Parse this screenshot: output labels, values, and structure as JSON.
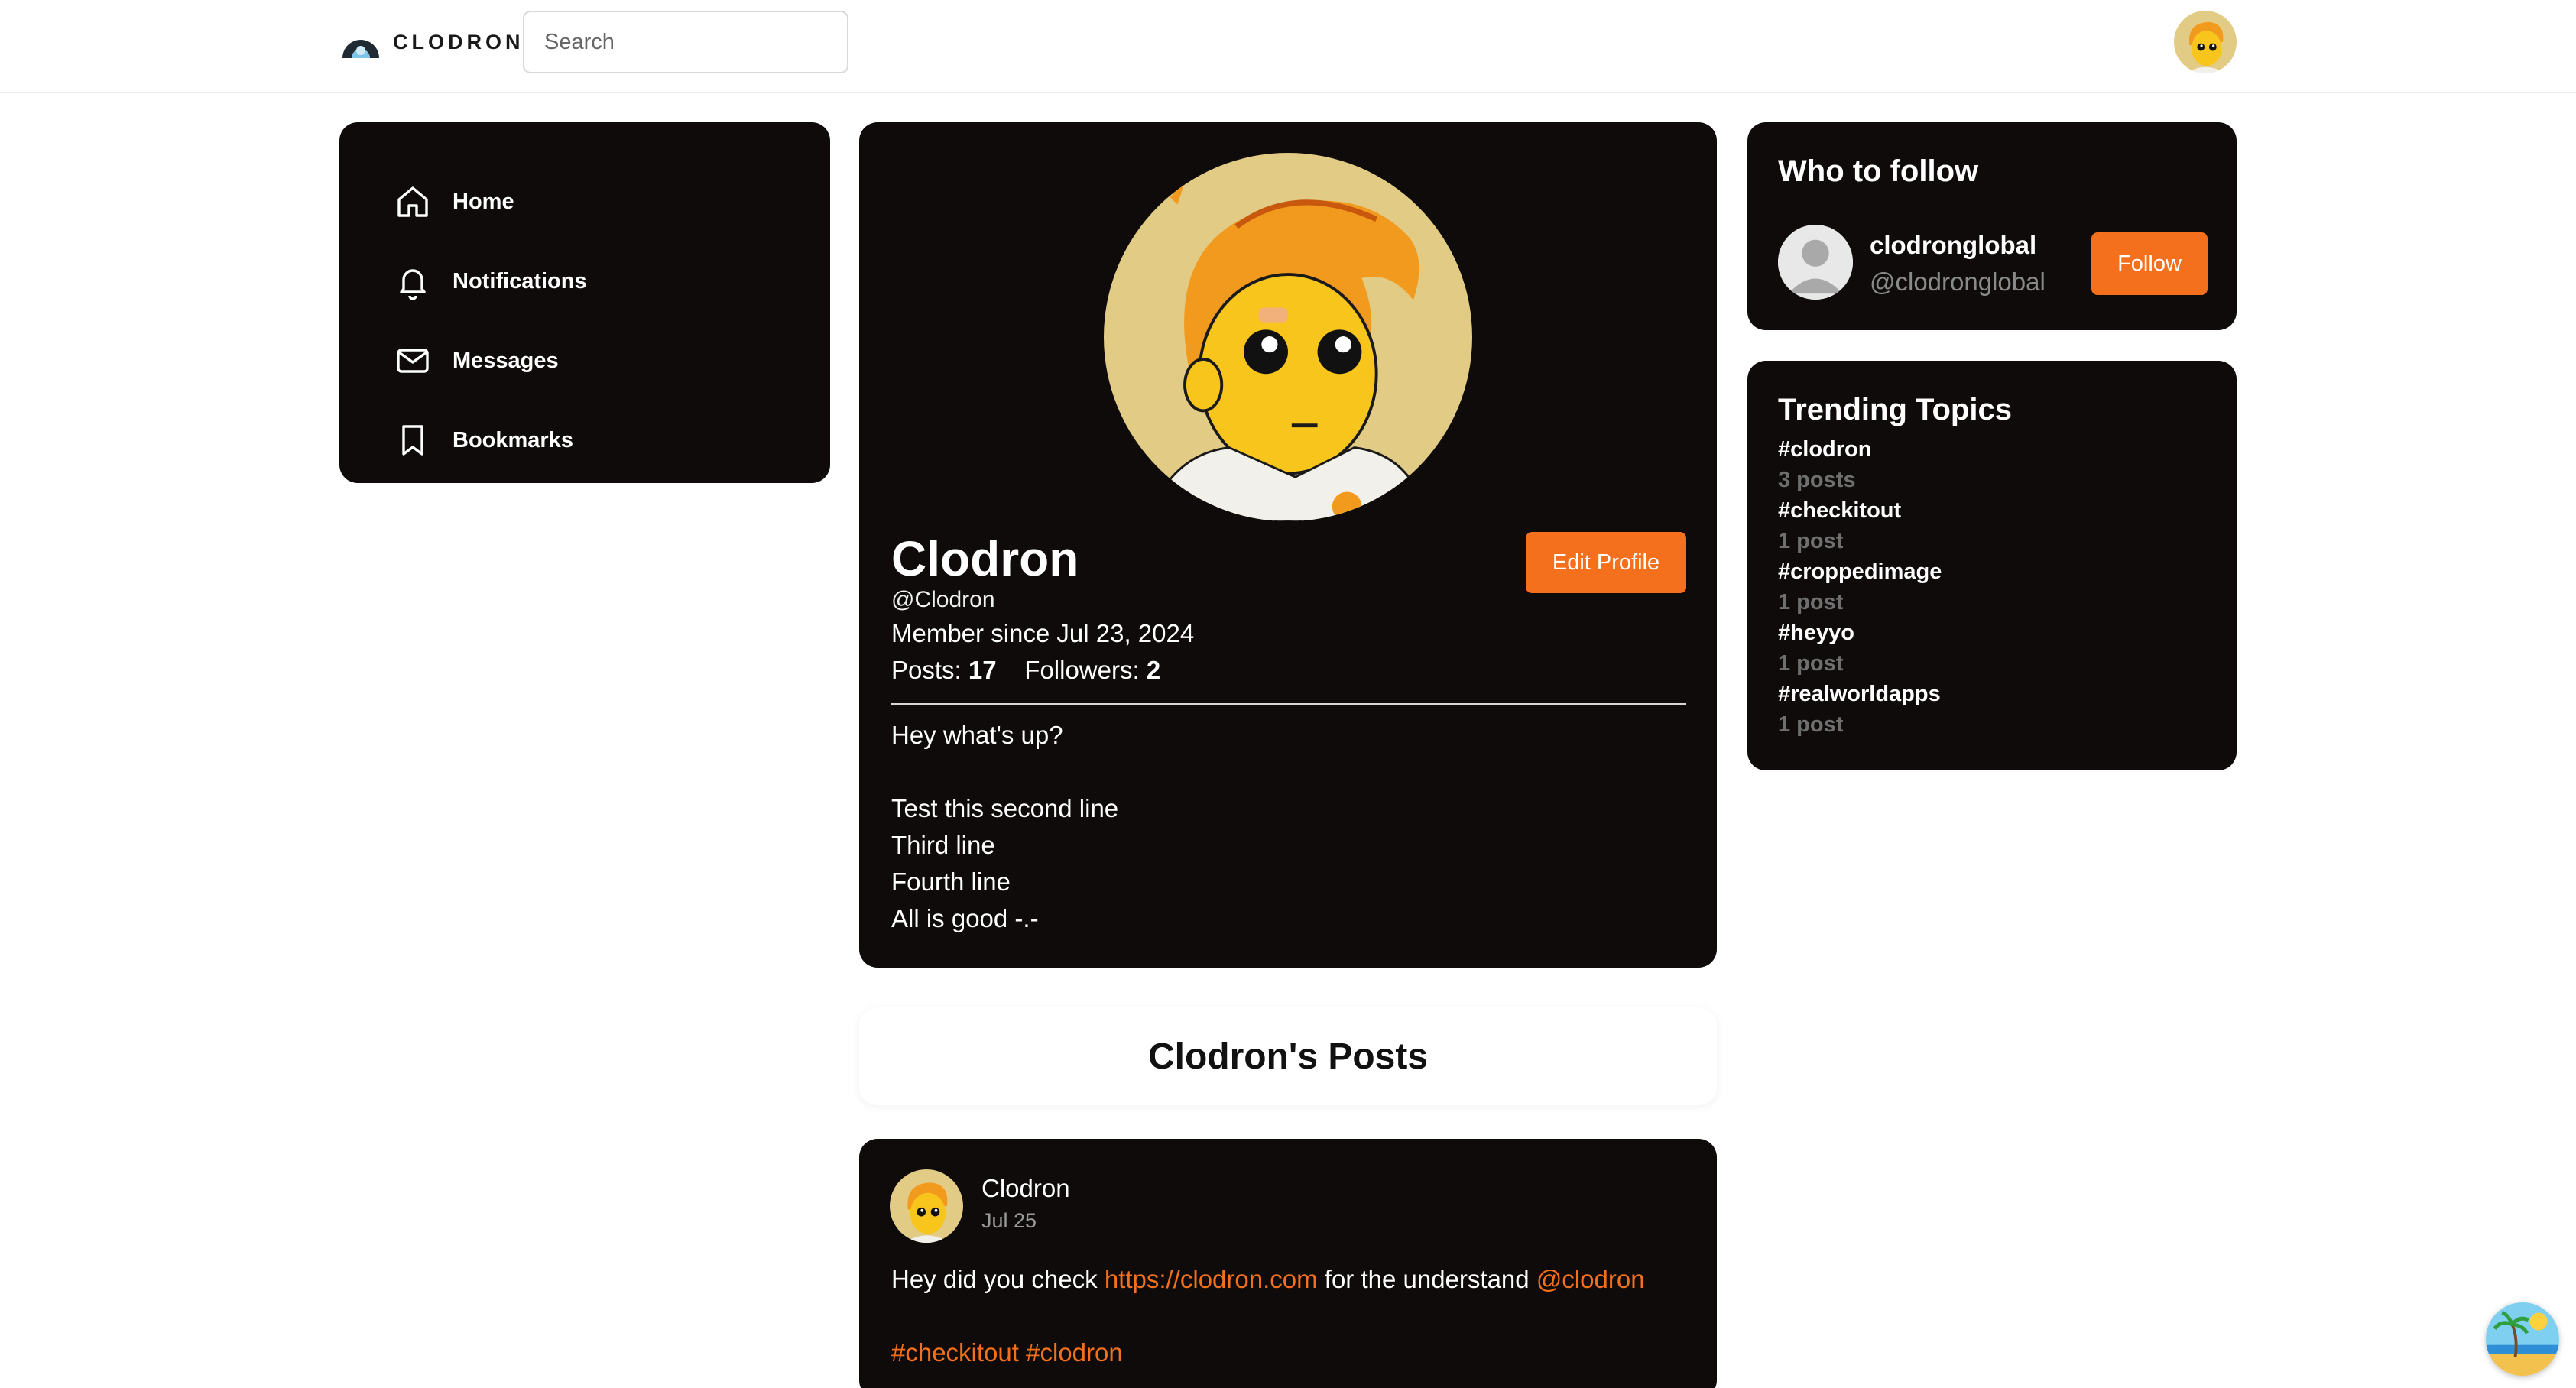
{
  "header": {
    "logo_text": "CLODRON",
    "search_placeholder": "Search"
  },
  "nav": {
    "items": [
      {
        "label": "Home",
        "icon": "home-icon"
      },
      {
        "label": "Notifications",
        "icon": "bell-icon"
      },
      {
        "label": "Messages",
        "icon": "mail-icon"
      },
      {
        "label": "Bookmarks",
        "icon": "bookmark-icon"
      }
    ]
  },
  "profile": {
    "name": "Clodron",
    "handle": "@Clodron",
    "member_since": "Member since Jul 23, 2024",
    "posts_label": "Posts:",
    "posts_count": "17",
    "followers_label": "Followers:",
    "followers_count": "2",
    "edit_label": "Edit Profile",
    "bio_lines": [
      "Hey what's up?",
      "",
      "Test this second line",
      "Third line",
      "Fourth line",
      "All is good -.-"
    ]
  },
  "posts_section": {
    "heading": "Clodron's Posts"
  },
  "post": {
    "author": "Clodron",
    "date": "Jul 25",
    "text_before": "Hey did you check ",
    "link": "https://clodron.com",
    "text_middle": " for the understand ",
    "mention": "@clodron",
    "tags": "#checkitout #clodron"
  },
  "who_to_follow": {
    "title": "Who to follow",
    "name": "clodronglobal",
    "handle": "@clodronglobal",
    "button_label": "Follow"
  },
  "trending": {
    "title": "Trending Topics",
    "topics": [
      {
        "tag": "#clodron",
        "count": "3 posts"
      },
      {
        "tag": "#checkitout",
        "count": "1 post"
      },
      {
        "tag": "#croppedimage",
        "count": "1 post"
      },
      {
        "tag": "#heyyo",
        "count": "1 post"
      },
      {
        "tag": "#realworldapps",
        "count": "1 post"
      }
    ]
  },
  "colors": {
    "accent": "#f4701d",
    "panel": "#0e0b0a"
  }
}
